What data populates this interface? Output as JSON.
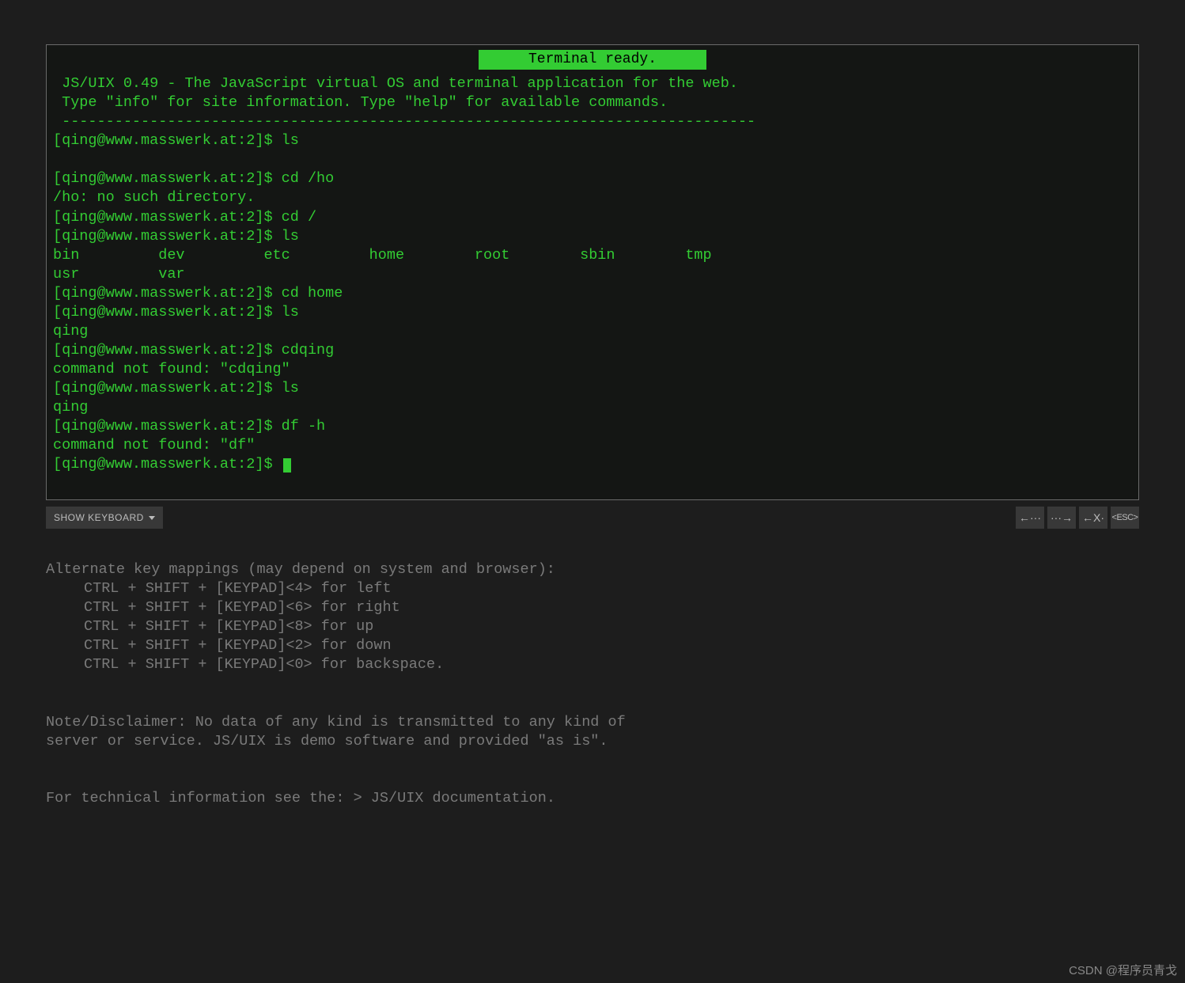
{
  "terminal": {
    "header": "Terminal ready.",
    "intro1": " JS/UIX 0.49 - The JavaScript virtual OS and terminal application for the web.",
    "intro2": " Type \"info\" for site information. Type \"help\" for available commands.",
    "divider": " -------------------------------------------------------------------------------",
    "prompt": "[qing@www.masswerk.at:2]$ ",
    "lines": [
      {
        "text": "[qing@www.masswerk.at:2]$ ls"
      },
      {
        "text": ""
      },
      {
        "text": "[qing@www.masswerk.at:2]$ cd /ho"
      },
      {
        "text": "/ho: no such directory."
      },
      {
        "text": "[qing@www.masswerk.at:2]$ cd /"
      },
      {
        "text": "[qing@www.masswerk.at:2]$ ls"
      },
      {
        "text": "bin         dev         etc         home        root        sbin        tmp"
      },
      {
        "text": "usr         var"
      },
      {
        "text": "[qing@www.masswerk.at:2]$ cd home"
      },
      {
        "text": "[qing@www.masswerk.at:2]$ ls"
      },
      {
        "text": "qing"
      },
      {
        "text": "[qing@www.masswerk.at:2]$ cdqing"
      },
      {
        "text": "command not found: \"cdqing\""
      },
      {
        "text": "[qing@www.masswerk.at:2]$ ls"
      },
      {
        "text": "qing"
      },
      {
        "text": "[qing@www.masswerk.at:2]$ df -h"
      },
      {
        "text": "command not found: \"df\""
      }
    ]
  },
  "toolbar": {
    "show_keyboard": "SHOW KEYBOARD",
    "left_arrow": "←···",
    "right_arrow": "···→",
    "backspace": "←X·",
    "escape": "<ESC>"
  },
  "info": {
    "heading": "Alternate key mappings (may depend on system and browser):",
    "maps": [
      "CTRL + SHIFT + [KEYPAD]<4> for left",
      "CTRL + SHIFT + [KEYPAD]<6> for right",
      "CTRL + SHIFT + [KEYPAD]<8> for up",
      "CTRL + SHIFT + [KEYPAD]<2> for down",
      "CTRL + SHIFT + [KEYPAD]<0> for backspace."
    ],
    "disclaimer1": "Note/Disclaimer: No data of any kind is transmitted to any kind of",
    "disclaimer2": "server or service. JS/UIX is demo software and provided \"as is\".",
    "tech_prefix": "For technical information see the: > ",
    "tech_link": "JS/UIX documentation."
  },
  "watermark": "CSDN @程序员青戈"
}
